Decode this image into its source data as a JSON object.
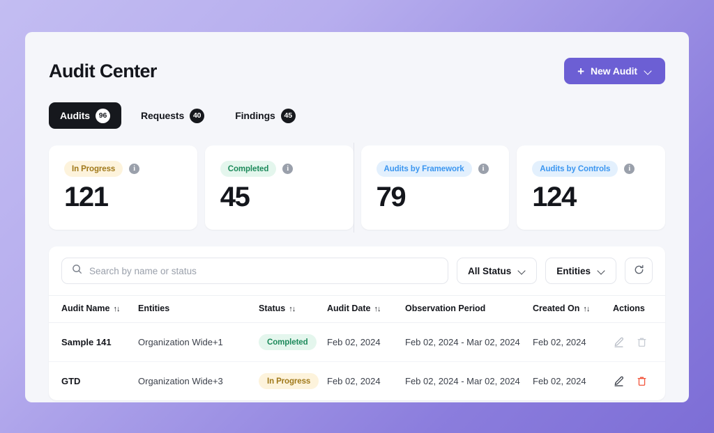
{
  "header": {
    "title": "Audit Center",
    "new_audit_label": "New Audit",
    "plus": "+"
  },
  "tabs": [
    {
      "label": "Audits",
      "count": "96",
      "active": true
    },
    {
      "label": "Requests",
      "count": "40",
      "active": false
    },
    {
      "label": "Findings",
      "count": "45",
      "active": false
    }
  ],
  "stats": [
    {
      "badge": "In Progress",
      "tone": "amber",
      "value": "121"
    },
    {
      "badge": "Completed",
      "tone": "green",
      "value": "45"
    },
    {
      "badge": "Audits by Framework",
      "tone": "blue",
      "value": "79"
    },
    {
      "badge": "Audits by Controls",
      "tone": "blue",
      "value": "124"
    }
  ],
  "toolbar": {
    "search_placeholder": "Search by name or status",
    "search_value": "",
    "status_filter": "All Status",
    "entities_filter": "Entities"
  },
  "table": {
    "columns": [
      {
        "label": "Audit Name",
        "sortable": true
      },
      {
        "label": "Entities",
        "sortable": false
      },
      {
        "label": "Status",
        "sortable": true
      },
      {
        "label": "Audit Date",
        "sortable": true
      },
      {
        "label": "Observation Period",
        "sortable": false
      },
      {
        "label": "Created On",
        "sortable": true
      },
      {
        "label": "Actions",
        "sortable": false
      }
    ],
    "sort_glyph": "↑↓",
    "rows": [
      {
        "name": "Sample 141",
        "entity": "Organization Wide",
        "entity_extra": "+1",
        "status": "Completed",
        "status_tone": "green",
        "audit_date": "Feb 02, 2024",
        "observation_period": "Feb 02, 2024 - Mar 02, 2024",
        "created_on": "Feb 02, 2024",
        "actions_muted": true
      },
      {
        "name": "GTD",
        "entity": "Organization Wide",
        "entity_extra": "+3",
        "status": "In Progress",
        "status_tone": "amber",
        "audit_date": "Feb 02, 2024",
        "observation_period": "Feb 02, 2024 - Mar 02, 2024",
        "created_on": "Feb 02, 2024",
        "actions_muted": false
      }
    ]
  },
  "colors": {
    "accent": "#6c5fd4",
    "active_tab": "#16181d",
    "amber_bg": "#fdf3dc",
    "amber_fg": "#a0791a",
    "green_bg": "#e4f6ed",
    "green_fg": "#1d8a5b",
    "blue_bg": "#e3f0fd",
    "blue_fg": "#3b96f0",
    "danger": "#f2563d"
  }
}
